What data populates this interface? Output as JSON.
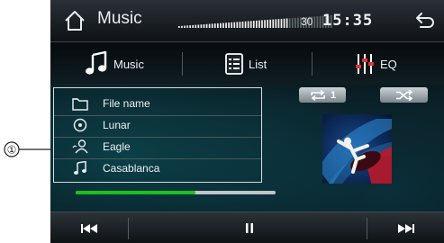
{
  "header": {
    "title": "Music",
    "volume_value": "30",
    "volume_level": 0.72,
    "clock": "15:35"
  },
  "tabs": [
    {
      "label": "Music"
    },
    {
      "label": "List"
    },
    {
      "label": "EQ"
    }
  ],
  "tracklist": {
    "rows": [
      {
        "icon": "folder-icon",
        "label": "File name"
      },
      {
        "icon": "disc-icon",
        "label": "Lunar"
      },
      {
        "icon": "artist-icon",
        "label": "Eagle"
      },
      {
        "icon": "music-note-icon",
        "label": "Casablanca"
      }
    ]
  },
  "controls": {
    "repeat_count": "1",
    "shuffle_icon": "shuffle-icon"
  },
  "playback": {
    "progress": 0.6
  },
  "annotation": {
    "label": "①"
  },
  "colors": {
    "accent_green": "#19c21e",
    "bar_cyan": "#2cc6d4"
  }
}
